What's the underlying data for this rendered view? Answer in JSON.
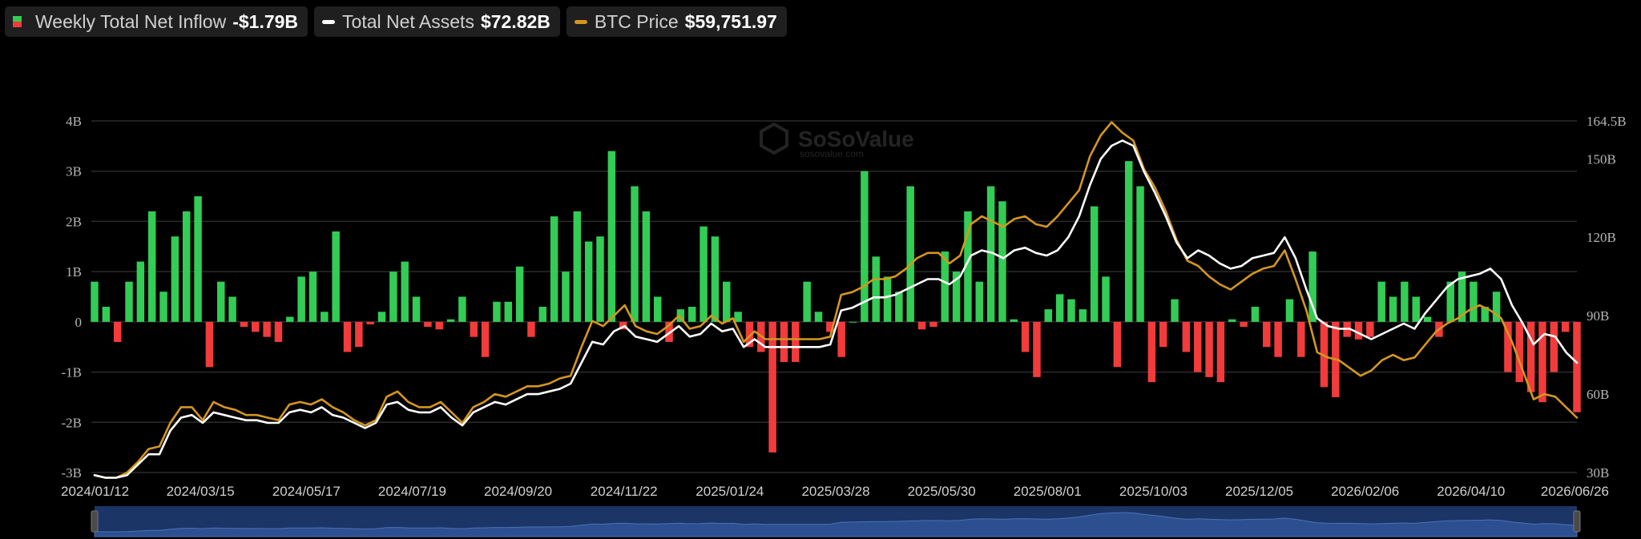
{
  "legend": {
    "inflow": {
      "label": "Weekly Total Net Inflow",
      "value": "-$1.79B"
    },
    "assets": {
      "label": "Total Net Assets",
      "value": "$72.82B"
    },
    "btc": {
      "label": "BTC Price",
      "value": "$59,751.97"
    }
  },
  "watermark": {
    "brand": "SoSoValue",
    "url": "sosovalue.com"
  },
  "colors": {
    "positive": "#33cc55",
    "negative": "#f23b3b",
    "assets_line": "#ffffff",
    "btc_line": "#d4961f",
    "grid": "#2b2b2b",
    "navigator": "#1b3566"
  },
  "chart_data": {
    "type": "bar",
    "xlabels": [
      "2024/01/12",
      "2024/03/15",
      "2024/05/17",
      "2024/07/19",
      "2024/09/20",
      "2024/11/22",
      "2025/01/24",
      "2025/03/28",
      "2025/05/30",
      "2025/08/01",
      "2025/10/03",
      "2025/12/05",
      "2026/02/06",
      "2026/04/10",
      "2026/06/26"
    ],
    "left_axis": {
      "ticks": [
        "4B",
        "3B",
        "2B",
        "1B",
        "0",
        "-1B",
        "-2B",
        "-3B"
      ],
      "ylim": [
        -3,
        4
      ],
      "unit": "B"
    },
    "right_axis": {
      "ticks": [
        "164.5B",
        "150B",
        "120B",
        "90B",
        "60B",
        "30B"
      ],
      "tick_values": [
        164.5,
        150,
        120,
        90,
        60,
        30
      ],
      "ylim": [
        30,
        164.5
      ],
      "unit": "B"
    },
    "series": [
      {
        "name": "Weekly Total Net Inflow",
        "kind": "bar",
        "values": [
          0.8,
          0.3,
          -0.4,
          0.8,
          1.2,
          2.2,
          0.6,
          1.7,
          2.2,
          2.5,
          -0.9,
          0.8,
          0.5,
          -0.1,
          -0.2,
          -0.3,
          -0.4,
          0.1,
          0.9,
          1.0,
          0.2,
          1.8,
          -0.6,
          -0.5,
          -0.05,
          0.2,
          1.0,
          1.2,
          0.5,
          -0.1,
          -0.15,
          0.05,
          0.5,
          -0.3,
          -0.7,
          0.4,
          0.4,
          1.1,
          -0.3,
          0.3,
          2.1,
          1.0,
          2.2,
          1.6,
          1.7,
          3.4,
          -0.15,
          2.7,
          2.2,
          0.5,
          -0.4,
          0.25,
          0.3,
          1.9,
          1.7,
          0.8,
          0.2,
          -0.5,
          -0.6,
          -2.6,
          -0.8,
          -0.8,
          0.8,
          0.2,
          -0.2,
          -0.7,
          0.0,
          3.0,
          1.3,
          0.9,
          0.6,
          2.7,
          -0.15,
          -0.1,
          1.4,
          1.0,
          2.2,
          0.8,
          2.7,
          2.4,
          0.05,
          -0.6,
          -1.1,
          0.25,
          0.55,
          0.45,
          0.25,
          2.3,
          0.9,
          -0.9,
          3.2,
          2.7,
          -1.2,
          -0.5,
          0.45,
          -0.6,
          -1.0,
          -1.1,
          -1.2,
          0.05,
          -0.1,
          0.3,
          -0.5,
          -0.7,
          0.45,
          -0.7,
          1.4,
          -1.3,
          -1.5,
          -0.3,
          -0.35,
          -0.3,
          0.8,
          0.5,
          0.8,
          0.5,
          0.1,
          -0.3,
          0.8,
          1.0,
          0.8,
          0.3,
          0.6,
          -1.0,
          -1.2,
          -1.4,
          -1.6,
          -1.0,
          -0.2,
          -1.8
        ]
      },
      {
        "name": "Total Net Assets",
        "kind": "line",
        "axis": "right",
        "values": [
          29,
          28,
          28,
          29,
          33,
          37,
          37,
          46,
          51,
          52,
          49,
          53,
          52,
          51,
          50,
          50,
          49,
          49,
          53,
          54,
          53,
          55,
          52,
          51,
          49,
          47,
          49,
          56,
          57,
          54,
          53,
          53,
          55,
          51,
          48,
          53,
          55,
          57,
          56,
          58,
          60,
          60,
          61,
          62,
          64,
          72,
          80,
          79,
          84,
          86,
          82,
          81,
          80,
          83,
          86,
          82,
          83,
          87,
          84,
          85,
          78,
          81,
          78,
          78,
          78,
          78,
          78,
          78,
          79,
          92,
          93,
          95,
          97,
          97,
          98,
          100,
          102,
          104,
          104,
          102,
          105,
          113,
          115,
          114,
          112,
          115,
          116,
          114,
          113,
          115,
          120,
          128,
          140,
          150,
          155,
          157,
          155,
          145,
          137,
          128,
          118,
          112,
          115,
          113,
          110,
          108,
          109,
          112,
          113,
          114,
          120,
          112,
          100,
          89,
          86,
          85,
          85,
          83,
          81,
          83,
          85,
          87,
          85,
          91,
          96,
          101,
          104,
          105,
          106,
          108,
          104,
          94,
          87,
          79,
          83,
          82,
          76,
          72
        ]
      },
      {
        "name": "BTC Price",
        "kind": "line",
        "axis": "right",
        "values": [
          29,
          28,
          28,
          30,
          34,
          39,
          40,
          49,
          55,
          55,
          50,
          57,
          55,
          54,
          52,
          52,
          51,
          50,
          56,
          57,
          56,
          58,
          55,
          53,
          50,
          48,
          50,
          59,
          61,
          57,
          55,
          55,
          57,
          53,
          49,
          55,
          57,
          60,
          59,
          61,
          63,
          63,
          64,
          66,
          67,
          78,
          88,
          86,
          90,
          94,
          86,
          84,
          83,
          86,
          90,
          85,
          86,
          90,
          87,
          89,
          80,
          84,
          81,
          81,
          81,
          81,
          81,
          81,
          82,
          98,
          99,
          101,
          104,
          104,
          105,
          108,
          112,
          114,
          114,
          110,
          113,
          125,
          128,
          126,
          124,
          127,
          128,
          125,
          124,
          128,
          133,
          138,
          151,
          159,
          164,
          160,
          157,
          146,
          139,
          130,
          119,
          111,
          109,
          105,
          102,
          100,
          103,
          106,
          108,
          109,
          115,
          104,
          92,
          76,
          74,
          73,
          70,
          67,
          69,
          73,
          75,
          73,
          74,
          79,
          84,
          87,
          89,
          92,
          94,
          92,
          89,
          80,
          69,
          58,
          60,
          59,
          55,
          51
        ]
      }
    ],
    "grid": true,
    "legend_placement": "top-left"
  }
}
